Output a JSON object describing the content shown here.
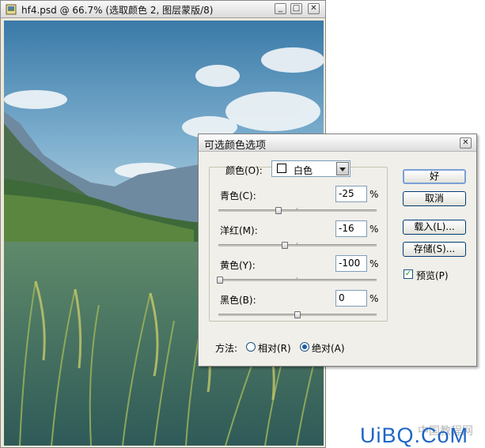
{
  "document_window": {
    "title": "hf4.psd @ 66.7% (选取颜色 2, 图层蒙版/8)",
    "icon": "photoshop-document-icon",
    "controls": {
      "minimize": "_",
      "maximize": "□",
      "close": "✕"
    }
  },
  "dialog": {
    "title": "可选颜色选项",
    "close": "✕",
    "colors_label": "颜色(O):",
    "colors_value": "白色",
    "swatch_color": "#ffffff",
    "sliders": [
      {
        "label": "青色(C):",
        "value": "-25",
        "unit": "%"
      },
      {
        "label": "洋红(M):",
        "value": "-16",
        "unit": "%"
      },
      {
        "label": "黄色(Y):",
        "value": "-100",
        "unit": "%"
      },
      {
        "label": "黑色(B):",
        "value": "0",
        "unit": "%"
      }
    ],
    "buttons": {
      "ok": "好",
      "cancel": "取消",
      "load": "载入(L)...",
      "save": "存储(S)..."
    },
    "preview_label": "预览(P)",
    "preview_checked": true,
    "method_label": "方法:",
    "method_options": [
      {
        "label": "相对(R)",
        "selected": false
      },
      {
        "label": "绝对(A)",
        "selected": true
      }
    ]
  },
  "watermark": {
    "text": "UiBQ.CoM",
    "sub": "中国教程网"
  },
  "colors": {
    "dialog_bg": "#f0efea",
    "default_button_border": "#7ba0d8",
    "watermark": "#1f66c7"
  }
}
